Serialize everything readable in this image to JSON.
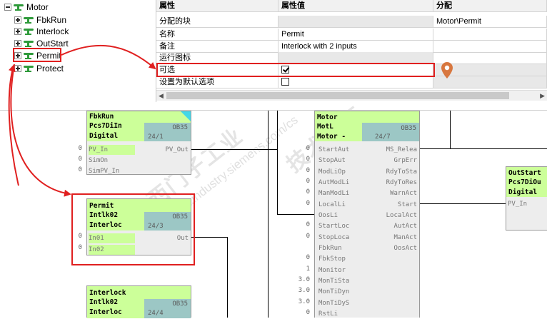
{
  "tree": {
    "root": {
      "label": "Motor"
    },
    "children": [
      {
        "label": "FbkRun"
      },
      {
        "label": "Interlock"
      },
      {
        "label": "OutStart"
      },
      {
        "label": "Permit"
      },
      {
        "label": "Protect"
      }
    ]
  },
  "props": {
    "headers": {
      "attr": "属性",
      "value": "属性值",
      "assign": "分配"
    },
    "rows": [
      {
        "attr": "分配的块",
        "value": "",
        "assign": "Motor\\Permit"
      },
      {
        "attr": "名称",
        "value": "Permit",
        "assign": ""
      },
      {
        "attr": "备注",
        "value": "Interlock with 2 inputs",
        "assign": ""
      },
      {
        "attr": "运行图标",
        "value": "",
        "assign": ""
      },
      {
        "attr": "可选",
        "value": "",
        "assign": ""
      },
      {
        "attr": "设置为默认选项",
        "value": "",
        "assign": ""
      }
    ],
    "optional_checked": true,
    "default_checked": false
  },
  "blocks": {
    "fbkrun": {
      "l1": "FbkRun",
      "l2": "Pcs7DiIn",
      "l3": "Digital",
      "ob": "OB35",
      "num": "24/1",
      "inputs": [
        {
          "val": "0",
          "name": "PV_In"
        },
        {
          "val": "0",
          "name": "SimOn"
        },
        {
          "val": "0",
          "name": "SimPV_In"
        }
      ],
      "outputs": [
        "PV_Out"
      ]
    },
    "permit": {
      "l1": "Permit",
      "l2": "Intlk02",
      "l3": "Interloc",
      "ob": "OB35",
      "num": "24/3",
      "inputs": [
        {
          "val": "0",
          "name": "In01"
        },
        {
          "val": "0",
          "name": "In02"
        }
      ],
      "outputs": [
        "Out"
      ]
    },
    "interlock": {
      "l1": "Interlock",
      "l2": "Intlk02",
      "l3": "Interloc",
      "ob": "OB35",
      "num": "24/4"
    },
    "motor": {
      "l1": "Motor",
      "l2": "MotL",
      "l3": "Motor -",
      "ob": "OB35",
      "num": "24/7",
      "inputs": [
        {
          "val": "0",
          "name": "StartAut"
        },
        {
          "val": "0",
          "name": "StopAut"
        },
        {
          "val": "0",
          "name": "ModLiOp"
        },
        {
          "val": "0",
          "name": "AutModLi"
        },
        {
          "val": "0",
          "name": "ManModLi"
        },
        {
          "val": "0",
          "name": "LocalLi"
        },
        {
          "val": "",
          "name": "OosLi"
        },
        {
          "val": "0",
          "name": "StartLoc"
        },
        {
          "val": "0",
          "name": "StopLoca"
        },
        {
          "val": "",
          "name": "FbkRun"
        },
        {
          "val": "0",
          "name": "FbkStop"
        },
        {
          "val": "1",
          "name": "Monitor"
        },
        {
          "val": "3.0",
          "name": "MonTiSta"
        },
        {
          "val": "3.0",
          "name": "MonTiDyn"
        },
        {
          "val": "3.0",
          "name": "MonTiDyS"
        },
        {
          "val": "0",
          "name": "RstLi"
        }
      ],
      "outputs": [
        "MS_Relea",
        "GrpErr",
        "RdyToSta",
        "RdyToRes",
        "WarnAct",
        "Start",
        "LocalAct",
        "AutAct",
        "ManAct",
        "OosAct"
      ]
    },
    "outstart": {
      "l1": "OutStart",
      "l2": "Pcs7DiOu",
      "l3": "Digital",
      "inputs": [
        {
          "name": "PV_In"
        }
      ]
    }
  },
  "watermark": {
    "text1": "西门子工业",
    "text2": "技术论坛",
    "text3": "support.industry.siemens.com/cs"
  },
  "colors": {
    "block_header": "#ccff99",
    "ob_zone": "#9cc7c5",
    "highlight": "#e02020"
  }
}
